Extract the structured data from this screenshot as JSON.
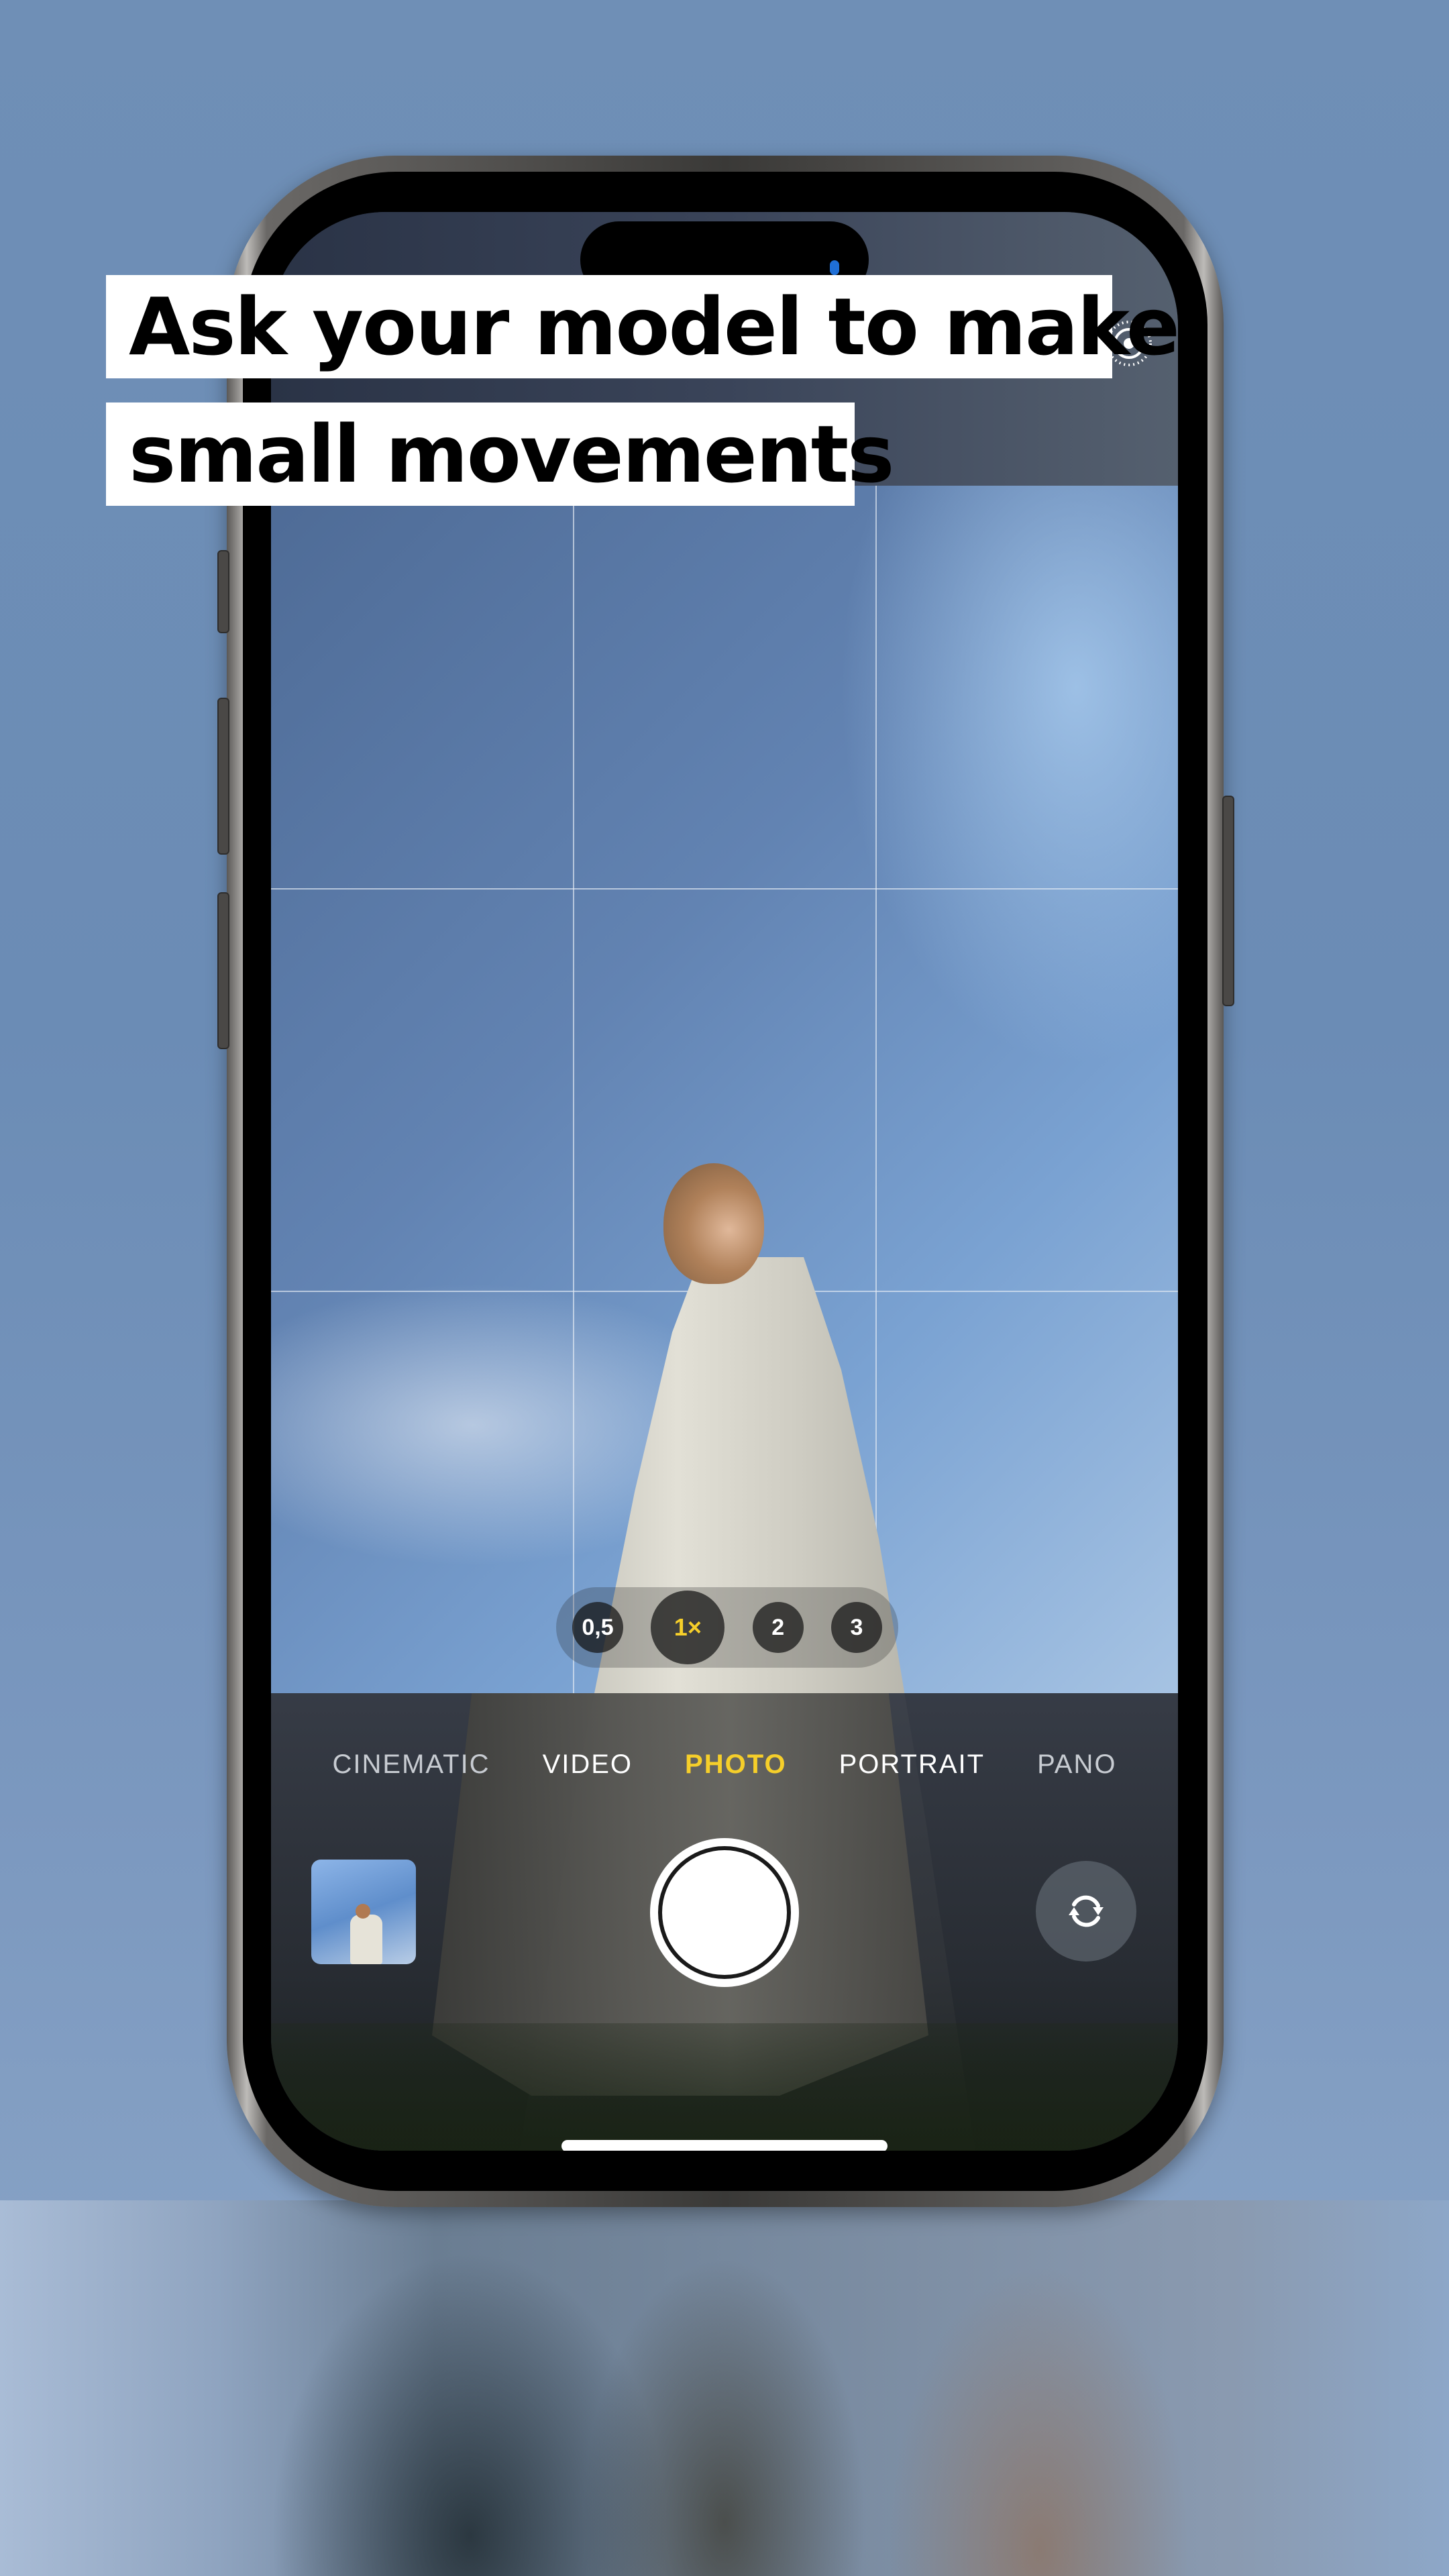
{
  "caption": {
    "line1": "Ask your model to make",
    "line2": "small movements"
  },
  "camera": {
    "zoom_levels": [
      {
        "label": "0,5",
        "active": false
      },
      {
        "label": "1×",
        "active": true
      },
      {
        "label": "2",
        "active": false
      },
      {
        "label": "3",
        "active": false
      }
    ],
    "modes": [
      {
        "label": "CINEMATIC",
        "active": false
      },
      {
        "label": "VIDEO",
        "active": false
      },
      {
        "label": "PHOTO",
        "active": true
      },
      {
        "label": "PORTRAIT",
        "active": false
      },
      {
        "label": "PANO",
        "active": false
      }
    ],
    "active_color": "#f6cf2a",
    "icons": {
      "live_photo": "live-photo-icon",
      "flip_camera": "camera-flip-icon",
      "shutter": "shutter-button",
      "thumbnail": "last-photo-thumbnail"
    }
  }
}
